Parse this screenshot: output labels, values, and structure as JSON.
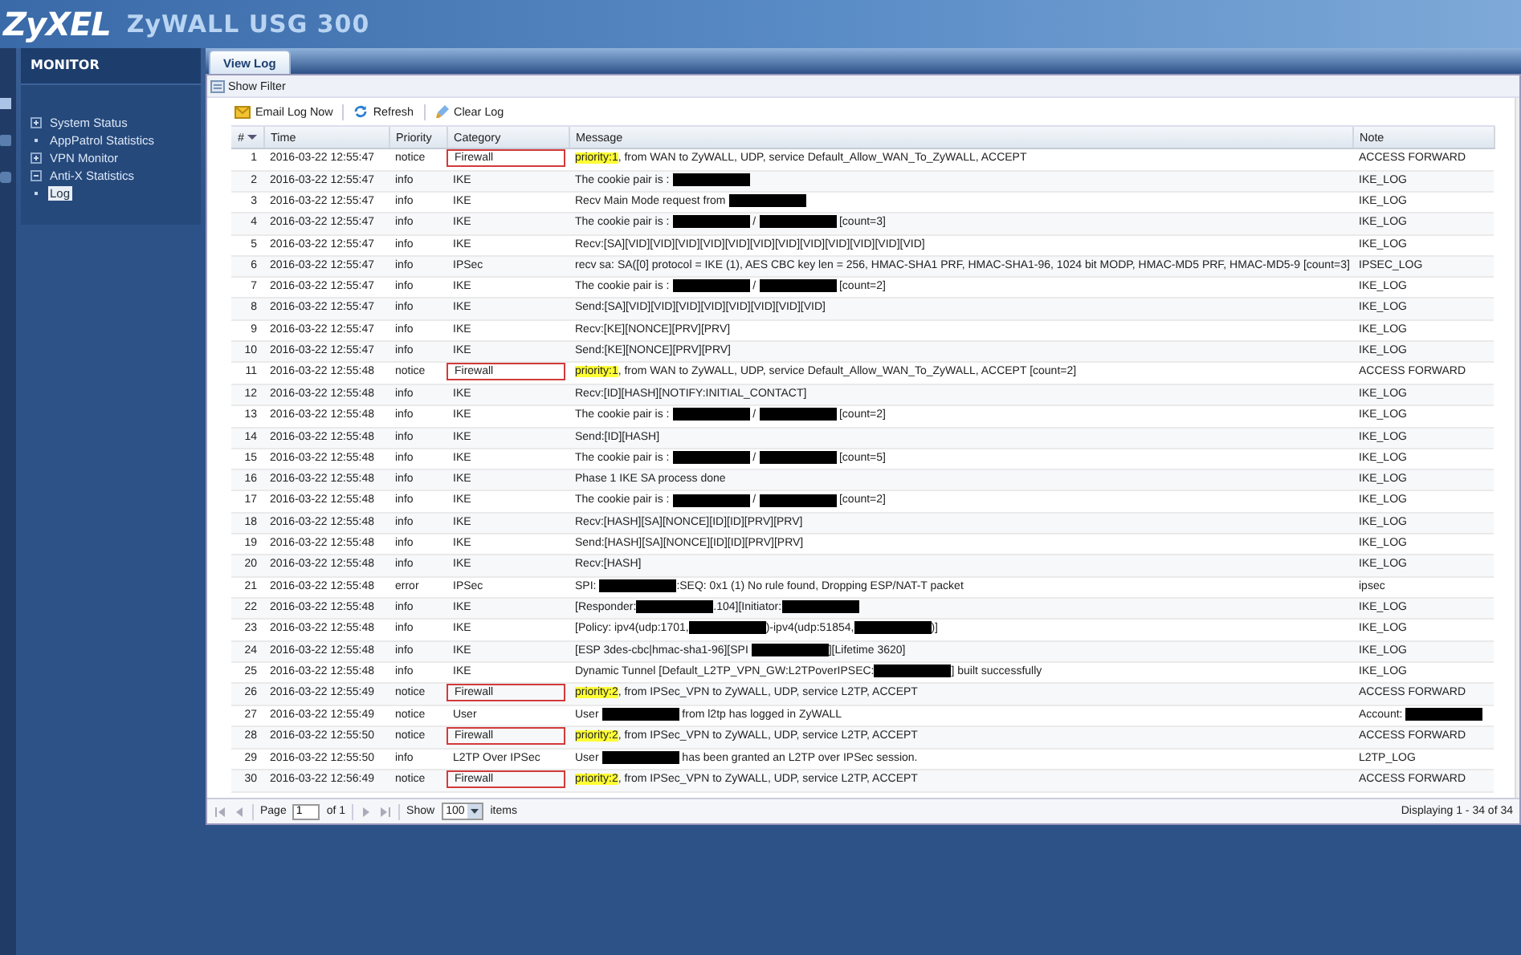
{
  "header": {
    "brand": "ZyXEL",
    "product": "ZyWALL USG 300"
  },
  "sidebar": {
    "title": "MONITOR",
    "items": [
      {
        "label": "System Status",
        "kind": "group",
        "expanded": false,
        "selected": false
      },
      {
        "label": "AppPatrol Statistics",
        "kind": "leaf",
        "selected": false
      },
      {
        "label": "VPN Monitor",
        "kind": "group",
        "expanded": false,
        "selected": false
      },
      {
        "label": "Anti-X Statistics",
        "kind": "group",
        "expanded": true,
        "selected": false
      },
      {
        "label": "Log",
        "kind": "leaf",
        "selected": true
      }
    ]
  },
  "tabs": [
    {
      "label": "View Log",
      "selected": true
    }
  ],
  "filter_toggle": "Show Filter",
  "toolbar": [
    {
      "label": "Email Log Now",
      "kind": "email"
    },
    {
      "label": "Refresh",
      "kind": "refresh"
    },
    {
      "label": "Clear Log",
      "kind": "clear"
    }
  ],
  "table": {
    "columns": [
      "#",
      "Time",
      "Priority",
      "Category",
      "Message",
      "Note"
    ],
    "rows": [
      {
        "num": "1",
        "time": "2016-03-22 12:55:47",
        "priority": "notice",
        "category": "Firewall",
        "flagged": true,
        "message": [
          {
            "kind": "highlight",
            "text": "priority:1"
          },
          ", from WAN to ZyWALL, UDP, service Default_Allow_WAN_To_ZyWALL, ACCEPT"
        ],
        "note": [
          "ACCESS FORWARD"
        ]
      },
      {
        "num": "2",
        "time": "2016-03-22 12:55:47",
        "priority": "info",
        "category": "IKE",
        "flagged": false,
        "message": [
          "The cookie pair is : ",
          {
            "kind": "redacted"
          }
        ],
        "note": [
          "IKE_LOG"
        ]
      },
      {
        "num": "3",
        "time": "2016-03-22 12:55:47",
        "priority": "info",
        "category": "IKE",
        "flagged": false,
        "message": [
          "Recv Main Mode request from ",
          {
            "kind": "redacted"
          }
        ],
        "note": [
          "IKE_LOG"
        ]
      },
      {
        "num": "4",
        "time": "2016-03-22 12:55:47",
        "priority": "info",
        "category": "IKE",
        "flagged": false,
        "message": [
          "The cookie pair is : ",
          {
            "kind": "redacted"
          },
          " / ",
          {
            "kind": "redacted"
          },
          " [count=3]"
        ],
        "note": [
          "IKE_LOG"
        ]
      },
      {
        "num": "5",
        "time": "2016-03-22 12:55:47",
        "priority": "info",
        "category": "IKE",
        "flagged": false,
        "message": [
          "Recv:[SA][VID][VID][VID][VID][VID][VID][VID][VID][VID][VID][VID][VID]"
        ],
        "note": [
          "IKE_LOG"
        ]
      },
      {
        "num": "6",
        "time": "2016-03-22 12:55:47",
        "priority": "info",
        "category": "IPSec",
        "flagged": false,
        "message": [
          "recv sa: SA([0] protocol = IKE (1), AES CBC key len = 256, HMAC-SHA1 PRF, HMAC-SHA1-96, 1024 bit MODP, HMAC-MD5 PRF, HMAC-MD5-9 [count=3]"
        ],
        "note": [
          "IPSEC_LOG"
        ]
      },
      {
        "num": "7",
        "time": "2016-03-22 12:55:47",
        "priority": "info",
        "category": "IKE",
        "flagged": false,
        "message": [
          "The cookie pair is : ",
          {
            "kind": "redacted"
          },
          " / ",
          {
            "kind": "redacted"
          },
          " [count=2]"
        ],
        "note": [
          "IKE_LOG"
        ]
      },
      {
        "num": "8",
        "time": "2016-03-22 12:55:47",
        "priority": "info",
        "category": "IKE",
        "flagged": false,
        "message": [
          "Send:[SA][VID][VID][VID][VID][VID][VID][VID][VID]"
        ],
        "note": [
          "IKE_LOG"
        ]
      },
      {
        "num": "9",
        "time": "2016-03-22 12:55:47",
        "priority": "info",
        "category": "IKE",
        "flagged": false,
        "message": [
          "Recv:[KE][NONCE][PRV][PRV]"
        ],
        "note": [
          "IKE_LOG"
        ]
      },
      {
        "num": "10",
        "time": "2016-03-22 12:55:47",
        "priority": "info",
        "category": "IKE",
        "flagged": false,
        "message": [
          "Send:[KE][NONCE][PRV][PRV]"
        ],
        "note": [
          "IKE_LOG"
        ]
      },
      {
        "num": "11",
        "time": "2016-03-22 12:55:48",
        "priority": "notice",
        "category": "Firewall",
        "flagged": true,
        "message": [
          {
            "kind": "highlight",
            "text": "priority:1"
          },
          ", from WAN to ZyWALL, UDP, service Default_Allow_WAN_To_ZyWALL, ACCEPT [count=2]"
        ],
        "note": [
          "ACCESS FORWARD"
        ]
      },
      {
        "num": "12",
        "time": "2016-03-22 12:55:48",
        "priority": "info",
        "category": "IKE",
        "flagged": false,
        "message": [
          "Recv:[ID][HASH][NOTIFY:INITIAL_CONTACT]"
        ],
        "note": [
          "IKE_LOG"
        ]
      },
      {
        "num": "13",
        "time": "2016-03-22 12:55:48",
        "priority": "info",
        "category": "IKE",
        "flagged": false,
        "message": [
          "The cookie pair is : ",
          {
            "kind": "redacted"
          },
          " / ",
          {
            "kind": "redacted"
          },
          " [count=2]"
        ],
        "note": [
          "IKE_LOG"
        ]
      },
      {
        "num": "14",
        "time": "2016-03-22 12:55:48",
        "priority": "info",
        "category": "IKE",
        "flagged": false,
        "message": [
          "Send:[ID][HASH]"
        ],
        "note": [
          "IKE_LOG"
        ]
      },
      {
        "num": "15",
        "time": "2016-03-22 12:55:48",
        "priority": "info",
        "category": "IKE",
        "flagged": false,
        "message": [
          "The cookie pair is : ",
          {
            "kind": "redacted"
          },
          " / ",
          {
            "kind": "redacted"
          },
          " [count=5]"
        ],
        "note": [
          "IKE_LOG"
        ]
      },
      {
        "num": "16",
        "time": "2016-03-22 12:55:48",
        "priority": "info",
        "category": "IKE",
        "flagged": false,
        "message": [
          "Phase 1 IKE SA process done"
        ],
        "note": [
          "IKE_LOG"
        ]
      },
      {
        "num": "17",
        "time": "2016-03-22 12:55:48",
        "priority": "info",
        "category": "IKE",
        "flagged": false,
        "message": [
          "The cookie pair is : ",
          {
            "kind": "redacted"
          },
          " / ",
          {
            "kind": "redacted"
          },
          " [count=2]"
        ],
        "note": [
          "IKE_LOG"
        ]
      },
      {
        "num": "18",
        "time": "2016-03-22 12:55:48",
        "priority": "info",
        "category": "IKE",
        "flagged": false,
        "message": [
          "Recv:[HASH][SA][NONCE][ID][ID][PRV][PRV]"
        ],
        "note": [
          "IKE_LOG"
        ]
      },
      {
        "num": "19",
        "time": "2016-03-22 12:55:48",
        "priority": "info",
        "category": "IKE",
        "flagged": false,
        "message": [
          "Send:[HASH][SA][NONCE][ID][ID][PRV][PRV]"
        ],
        "note": [
          "IKE_LOG"
        ]
      },
      {
        "num": "20",
        "time": "2016-03-22 12:55:48",
        "priority": "info",
        "category": "IKE",
        "flagged": false,
        "message": [
          "Recv:[HASH]"
        ],
        "note": [
          "IKE_LOG"
        ]
      },
      {
        "num": "21",
        "time": "2016-03-22 12:55:48",
        "priority": "error",
        "category": "IPSec",
        "flagged": false,
        "message": [
          "SPI: ",
          {
            "kind": "redacted"
          },
          ":SEQ: 0x1 (1) No rule found, Dropping ESP/NAT-T packet"
        ],
        "note": [
          "ipsec"
        ]
      },
      {
        "num": "22",
        "time": "2016-03-22 12:55:48",
        "priority": "info",
        "category": "IKE",
        "flagged": false,
        "message": [
          "[Responder:",
          {
            "kind": "redacted"
          },
          ".104][Initiator:",
          {
            "kind": "redacted"
          }
        ],
        "note": [
          "IKE_LOG"
        ]
      },
      {
        "num": "23",
        "time": "2016-03-22 12:55:48",
        "priority": "info",
        "category": "IKE",
        "flagged": false,
        "message": [
          "[Policy: ipv4(udp:1701,",
          {
            "kind": "redacted"
          },
          ")-ipv4(udp:51854,",
          {
            "kind": "redacted"
          },
          ")]"
        ],
        "note": [
          "IKE_LOG"
        ]
      },
      {
        "num": "24",
        "time": "2016-03-22 12:55:48",
        "priority": "info",
        "category": "IKE",
        "flagged": false,
        "message": [
          "[ESP 3des-cbc|hmac-sha1-96][SPI ",
          {
            "kind": "redacted"
          },
          "][Lifetime 3620]"
        ],
        "note": [
          "IKE_LOG"
        ]
      },
      {
        "num": "25",
        "time": "2016-03-22 12:55:48",
        "priority": "info",
        "category": "IKE",
        "flagged": false,
        "message": [
          "Dynamic Tunnel [Default_L2TP_VPN_GW:L2TPoverIPSEC:",
          {
            "kind": "redacted"
          },
          "] built successfully"
        ],
        "note": [
          "IKE_LOG"
        ]
      },
      {
        "num": "26",
        "time": "2016-03-22 12:55:49",
        "priority": "notice",
        "category": "Firewall",
        "flagged": true,
        "message": [
          {
            "kind": "highlight",
            "text": "priority:2"
          },
          ", from IPSec_VPN to ZyWALL, UDP, service L2TP, ACCEPT"
        ],
        "note": [
          "ACCESS FORWARD"
        ]
      },
      {
        "num": "27",
        "time": "2016-03-22 12:55:49",
        "priority": "notice",
        "category": "User",
        "flagged": false,
        "message": [
          "User ",
          {
            "kind": "redacted"
          },
          " from l2tp has logged in ZyWALL"
        ],
        "note": [
          "Account: ",
          {
            "kind": "redacted"
          }
        ]
      },
      {
        "num": "28",
        "time": "2016-03-22 12:55:50",
        "priority": "notice",
        "category": "Firewall",
        "flagged": true,
        "message": [
          {
            "kind": "highlight",
            "text": "priority:2"
          },
          ", from IPSec_VPN to ZyWALL, UDP, service L2TP, ACCEPT"
        ],
        "note": [
          "ACCESS FORWARD"
        ]
      },
      {
        "num": "29",
        "time": "2016-03-22 12:55:50",
        "priority": "info",
        "category": "L2TP Over IPSec",
        "flagged": false,
        "message": [
          "User ",
          {
            "kind": "redacted"
          },
          " has been granted an L2TP over IPSec session."
        ],
        "note": [
          "L2TP_LOG"
        ]
      },
      {
        "num": "30",
        "time": "2016-03-22 12:56:49",
        "priority": "notice",
        "category": "Firewall",
        "flagged": true,
        "message": [
          {
            "kind": "highlight",
            "text": "priority:2"
          },
          ", from IPSec_VPN to ZyWALL, UDP, service L2TP, ACCEPT"
        ],
        "note": [
          "ACCESS FORWARD"
        ]
      }
    ]
  },
  "pager": {
    "page_label": "Page",
    "page": "1",
    "of": "of 1",
    "show_label": "Show",
    "page_size": "100",
    "items_label": "items",
    "summary": "Displaying 1 - 34 of 34"
  }
}
